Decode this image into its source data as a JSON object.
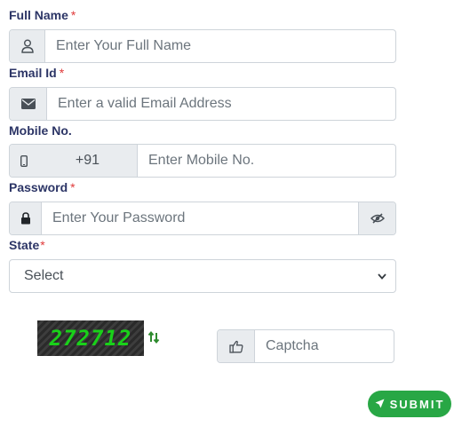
{
  "form": {
    "full_name": {
      "label": "Full Name",
      "required_mark": "*",
      "placeholder": "Enter Your Full Name",
      "icon": "user-icon"
    },
    "email": {
      "label": "Email Id",
      "required_mark": "*",
      "placeholder": "Enter a valid Email Address",
      "icon": "envelope-icon"
    },
    "mobile": {
      "label": "Mobile No.",
      "country_code": "+91",
      "placeholder": "Enter Mobile No.",
      "icon": "mobile-icon"
    },
    "password": {
      "label": "Password",
      "required_mark": "*",
      "placeholder": "Enter Your Password",
      "icon": "lock-icon",
      "toggle_icon": "eye-slash-icon"
    },
    "state": {
      "label": "State",
      "required_mark": "*",
      "selected": "Select"
    },
    "captcha": {
      "code": "272712",
      "placeholder": "Captcha",
      "refresh_icon": "refresh-icon",
      "icon": "thumbs-up-icon"
    },
    "submit": {
      "label": "SUBMIT",
      "icon": "paper-plane-icon"
    }
  },
  "colors": {
    "label": "#2c3566",
    "required": "#e03a3a",
    "addon_bg": "#e9ecef",
    "border": "#ced4da",
    "submit_bg": "#28a745",
    "captcha_text": "#19d119",
    "refresh": "#2e8b2e"
  }
}
